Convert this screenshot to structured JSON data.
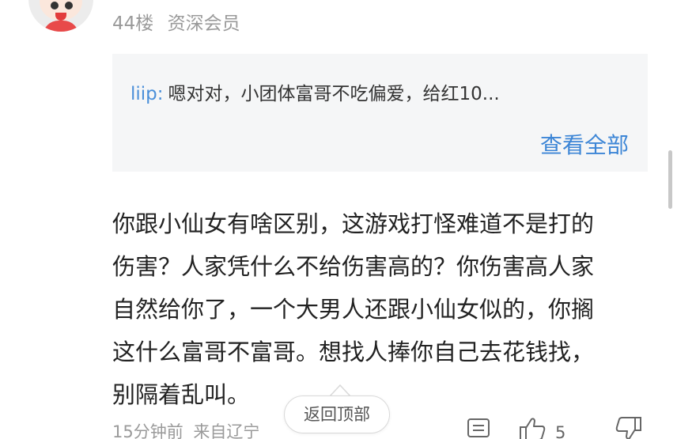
{
  "comment": {
    "floor": "44楼",
    "member_level": "资深会员",
    "quoted_reply": {
      "user": "liip",
      "separator": ":",
      "text": "嗯对对，小团体富哥不吃偏爱，给红10...",
      "view_all_label": "查看全部"
    },
    "body_lines": [
      "你跟小仙女有啥区别，这游戏打怪难道不是打的",
      "伤害？人家凭什么不给伤害高的？你伤害高人家",
      "自然给你了，一个大男人还跟小仙女似的，你搁",
      "这什么富哥不富哥。想找人捧你自己去花钱找，",
      "别隔着乱叫。"
    ],
    "time_ago": "15分钟前",
    "location": "来自辽宁",
    "like_count": "5"
  },
  "back_to_top_label": "返回顶部",
  "icons": {
    "comment": "comment-icon",
    "like": "thumbs-up-icon",
    "dislike": "thumbs-down-icon"
  },
  "colors": {
    "link_blue": "#3d86d6",
    "meta_gray": "#9a9a9a",
    "quote_bg": "#f5f6f7",
    "text": "#222222"
  }
}
